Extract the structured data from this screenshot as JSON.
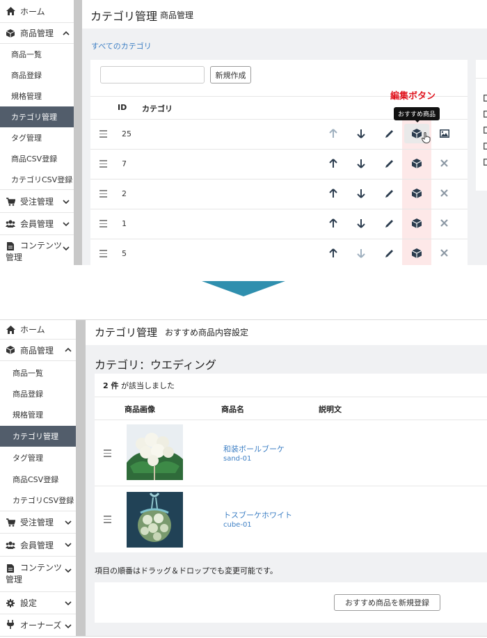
{
  "top": {
    "sidebar": {
      "home": "ホーム",
      "products_group": "商品管理",
      "subitems": [
        "商品一覧",
        "商品登録",
        "規格管理",
        "カテゴリ管理",
        "タグ管理",
        "商品CSV登録",
        "カテゴリCSV登録"
      ],
      "orders": "受注管理",
      "members": "会員管理",
      "contents_line1": "コンテンツ",
      "contents_line2": "管理"
    },
    "page_title": "カテゴリ管理",
    "page_subtitle": "商品管理",
    "breadcrumb_all": "すべてのカテゴリ",
    "search_value": "",
    "new_button": "新規作成",
    "annotation_label": "編集ボタン",
    "tooltip": "おすすめ商品",
    "table_headers": {
      "id": "ID",
      "category": "カテゴリ"
    },
    "rows": [
      {
        "id": "25"
      },
      {
        "id": "7"
      },
      {
        "id": "2"
      },
      {
        "id": "1"
      },
      {
        "id": "5"
      }
    ]
  },
  "bottom": {
    "sidebar": {
      "home": "ホーム",
      "products_group": "商品管理",
      "subitems": [
        "商品一覧",
        "商品登録",
        "規格管理",
        "カテゴリ管理",
        "タグ管理",
        "商品CSV登録",
        "カテゴリCSV登録"
      ],
      "orders": "受注管理",
      "members": "会員管理",
      "contents_line1": "コンテンツ",
      "contents_line2": "管理",
      "settings": "設定",
      "owners": "オーナーズ"
    },
    "page_title": "カテゴリ管理",
    "page_subtitle": "おすすめ商品内容設定",
    "category_heading": "カテゴリ：ウエディング",
    "count_number": "2 件",
    "count_suffix": "が該当しました",
    "table_headers": {
      "image": "商品画像",
      "name": "商品名",
      "description": "説明文"
    },
    "products": [
      {
        "name": "和装ボールブーケ",
        "code": "sand-01"
      },
      {
        "name": "トスブーケホワイト",
        "code": "cube-01"
      }
    ],
    "drag_note": "項目の順番はドラッグ＆ドロップでも変更可能です。",
    "register_button": "おすすめ商品を新規登録"
  },
  "colors": {
    "active_nav": "#525d6b",
    "link": "#3d7fc4",
    "annotation": "#e0141e",
    "highlight_column": "#fde8e8",
    "divider_arrow": "#2f8fae"
  }
}
